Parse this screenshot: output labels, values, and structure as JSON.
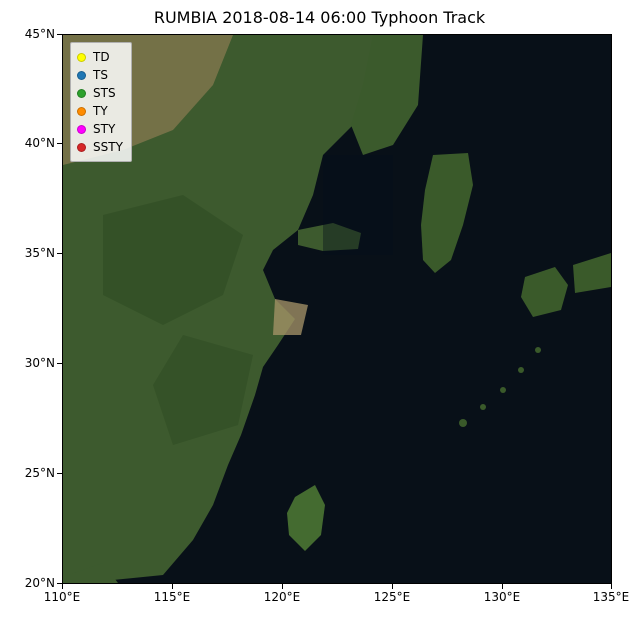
{
  "chart_data": {
    "type": "scatter",
    "title": "RUMBIA 2018-08-14 06:00 Typhoon Track",
    "xlabel": "",
    "ylabel": "",
    "xlim": [
      110,
      135
    ],
    "ylim": [
      20,
      45
    ],
    "xticks": [
      110,
      115,
      120,
      125,
      130,
      135
    ],
    "yticks": [
      20,
      25,
      30,
      35,
      40,
      45
    ],
    "xtick_labels": [
      "110°E",
      "115°E",
      "120°E",
      "125°E",
      "130°E",
      "135°E"
    ],
    "ytick_labels": [
      "20°N",
      "25°N",
      "30°N",
      "35°N",
      "40°N",
      "45°N"
    ],
    "series": [],
    "legend": {
      "position": "upper left",
      "items": [
        {
          "label": "TD",
          "color": "#ffff00"
        },
        {
          "label": "TS",
          "color": "#1f77b4"
        },
        {
          "label": "STS",
          "color": "#2ca02c"
        },
        {
          "label": "TY",
          "color": "#ff8c00"
        },
        {
          "label": "STY",
          "color": "#ff00ff"
        },
        {
          "label": "SSTY",
          "color": "#d62728"
        }
      ]
    }
  }
}
